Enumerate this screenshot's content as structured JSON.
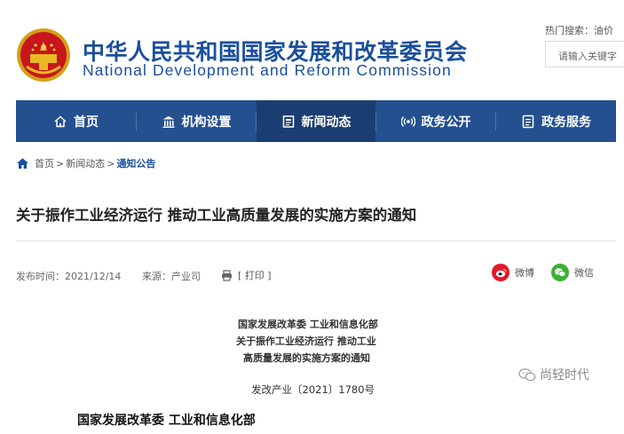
{
  "header": {
    "title_cn": "中华人民共和国国家发展和改革委员会",
    "title_en": "National Development and Reform Commission",
    "hot_search_label": "热门搜索：油价",
    "search_placeholder": "请输入关键字"
  },
  "nav": {
    "items": [
      {
        "label": "首页",
        "icon": "home-icon"
      },
      {
        "label": "机构设置",
        "icon": "building-icon"
      },
      {
        "label": "新闻动态",
        "icon": "news-icon"
      },
      {
        "label": "政务公开",
        "icon": "broadcast-icon"
      },
      {
        "label": "政务服务",
        "icon": "service-icon"
      }
    ],
    "active_index": 2,
    "bg_color": "#24508f",
    "active_color": "#1a3d72"
  },
  "breadcrumb": {
    "home": "首页",
    "sep": ">",
    "section": "新闻动态",
    "current": "通知公告"
  },
  "article": {
    "title": "关于振作工业经济运行 推动工业高质量发展的实施方案的通知",
    "publish_time": "发布时间：2021/12/14",
    "source": "来源：产业司",
    "print_label": "[ 打印 ]",
    "share_weibo": "微博",
    "share_wechat": "微信"
  },
  "document": {
    "line1": "国家发展改革委 工业和信息化部",
    "line2": "关于振作工业经济运行 推动工业",
    "line3": "高质量发展的实施方案的通知",
    "doc_number": "发改产业〔2021〕1780号",
    "para_start": "国家发展改革委 工业和信息化部"
  },
  "watermark": {
    "text": "尚轻时代"
  }
}
